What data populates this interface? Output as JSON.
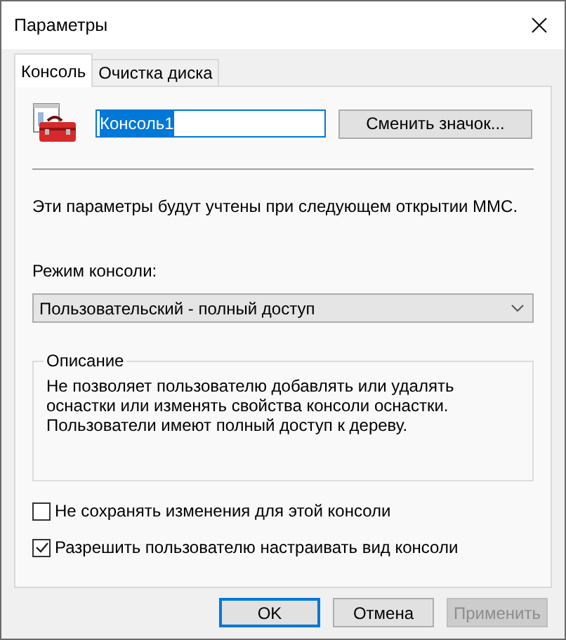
{
  "window": {
    "title": "Параметры"
  },
  "tabs": [
    {
      "label": "Консоль",
      "selected": true
    },
    {
      "label": "Очистка диска",
      "selected": false
    }
  ],
  "console_name": {
    "value": "Консоль1",
    "text_selected": true
  },
  "change_icon_button": "Сменить значок...",
  "notice": "Эти параметры будут учтены при следующем открытии MMC.",
  "mode": {
    "label": "Режим консоли:",
    "value": "Пользовательский - полный доступ"
  },
  "description": {
    "title": "Описание",
    "text": "Не позволяет пользователю добавлять или удалять оснастки или изменять свойства консоли оснастки. Пользователи имеют полный доступ к дереву."
  },
  "checkboxes": [
    {
      "label": "Не сохранять изменения для этой консоли",
      "checked": false
    },
    {
      "label": "Разрешить пользователю настраивать вид консоли",
      "checked": true
    }
  ],
  "buttons": [
    {
      "label": "OK",
      "default": true,
      "disabled": false
    },
    {
      "label": "Отмена",
      "default": false,
      "disabled": false
    },
    {
      "label": "Применить",
      "default": false,
      "disabled": true
    }
  ]
}
